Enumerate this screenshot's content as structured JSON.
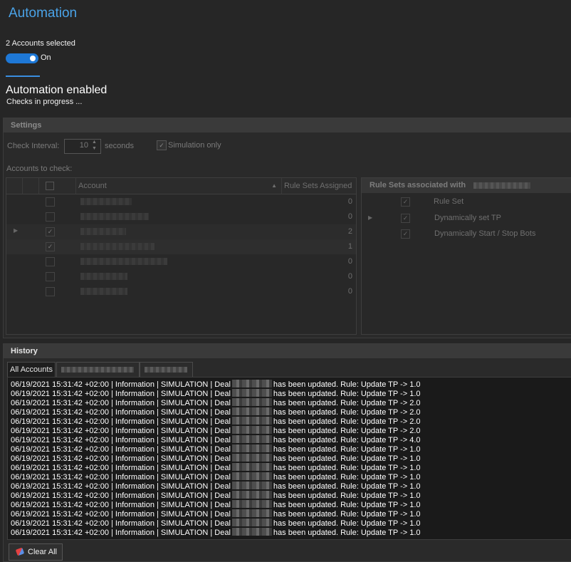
{
  "page": {
    "title": "Automation"
  },
  "selection": {
    "text": "2 Accounts selected"
  },
  "toggle": {
    "label": "On",
    "state": "on"
  },
  "status": {
    "title": "Automation enabled",
    "subtitle": "Checks in progress ..."
  },
  "settings": {
    "header": "Settings",
    "check_interval_label": "Check Interval:",
    "check_interval_value": "10",
    "seconds_label": "seconds",
    "simulation_label": "Simulation only",
    "simulation_checked": true,
    "accounts_label": "Accounts to check:"
  },
  "accounts_grid": {
    "columns": [
      "Account",
      "Rule Sets Assigned"
    ],
    "rows": [
      {
        "checked": false,
        "assigned": "0"
      },
      {
        "checked": false,
        "assigned": "0"
      },
      {
        "checked": true,
        "assigned": "2"
      },
      {
        "checked": true,
        "assigned": "1"
      },
      {
        "checked": false,
        "assigned": "0"
      },
      {
        "checked": false,
        "assigned": "0"
      },
      {
        "checked": false,
        "assigned": "0"
      }
    ]
  },
  "rule_sets": {
    "header": "Rule Sets associated with",
    "column": "Rule Set",
    "rows": [
      {
        "checked": true,
        "name": "Dynamically set TP"
      },
      {
        "checked": true,
        "name": "Dynamically Start / Stop Bots"
      }
    ]
  },
  "history": {
    "header": "History",
    "tabs": [
      {
        "label": "All Accounts"
      }
    ],
    "log_prefix": "06/19/2021 15:31:42 +02:00 | Information | SIMULATION | Deal",
    "log_suffixes": [
      "has been updated. Rule: Update TP -> 1.0",
      "has been updated. Rule: Update TP -> 1.0",
      "has been updated. Rule: Update TP -> 2.0",
      "has been updated. Rule: Update TP -> 2.0",
      "has been updated. Rule: Update TP -> 2.0",
      "has been updated. Rule: Update TP -> 2.0",
      "has been updated. Rule: Update TP -> 4.0",
      "has been updated. Rule: Update TP -> 1.0",
      "has been updated. Rule: Update TP -> 1.0",
      "has been updated. Rule: Update TP -> 1.0",
      "has been updated. Rule: Update TP -> 1.0",
      "has been updated. Rule: Update TP -> 1.0",
      "has been updated. Rule: Update TP -> 1.0",
      "has been updated. Rule: Update TP -> 1.0",
      "has been updated. Rule: Update TP -> 1.0",
      "has been updated. Rule: Update TP -> 1.0",
      "has been updated. Rule: Update TP -> 1.0"
    ],
    "clear_label": "Clear All"
  },
  "colors": {
    "accent": "#4aa3e8",
    "toggle_on": "#1e78d6",
    "background": "#262626"
  }
}
